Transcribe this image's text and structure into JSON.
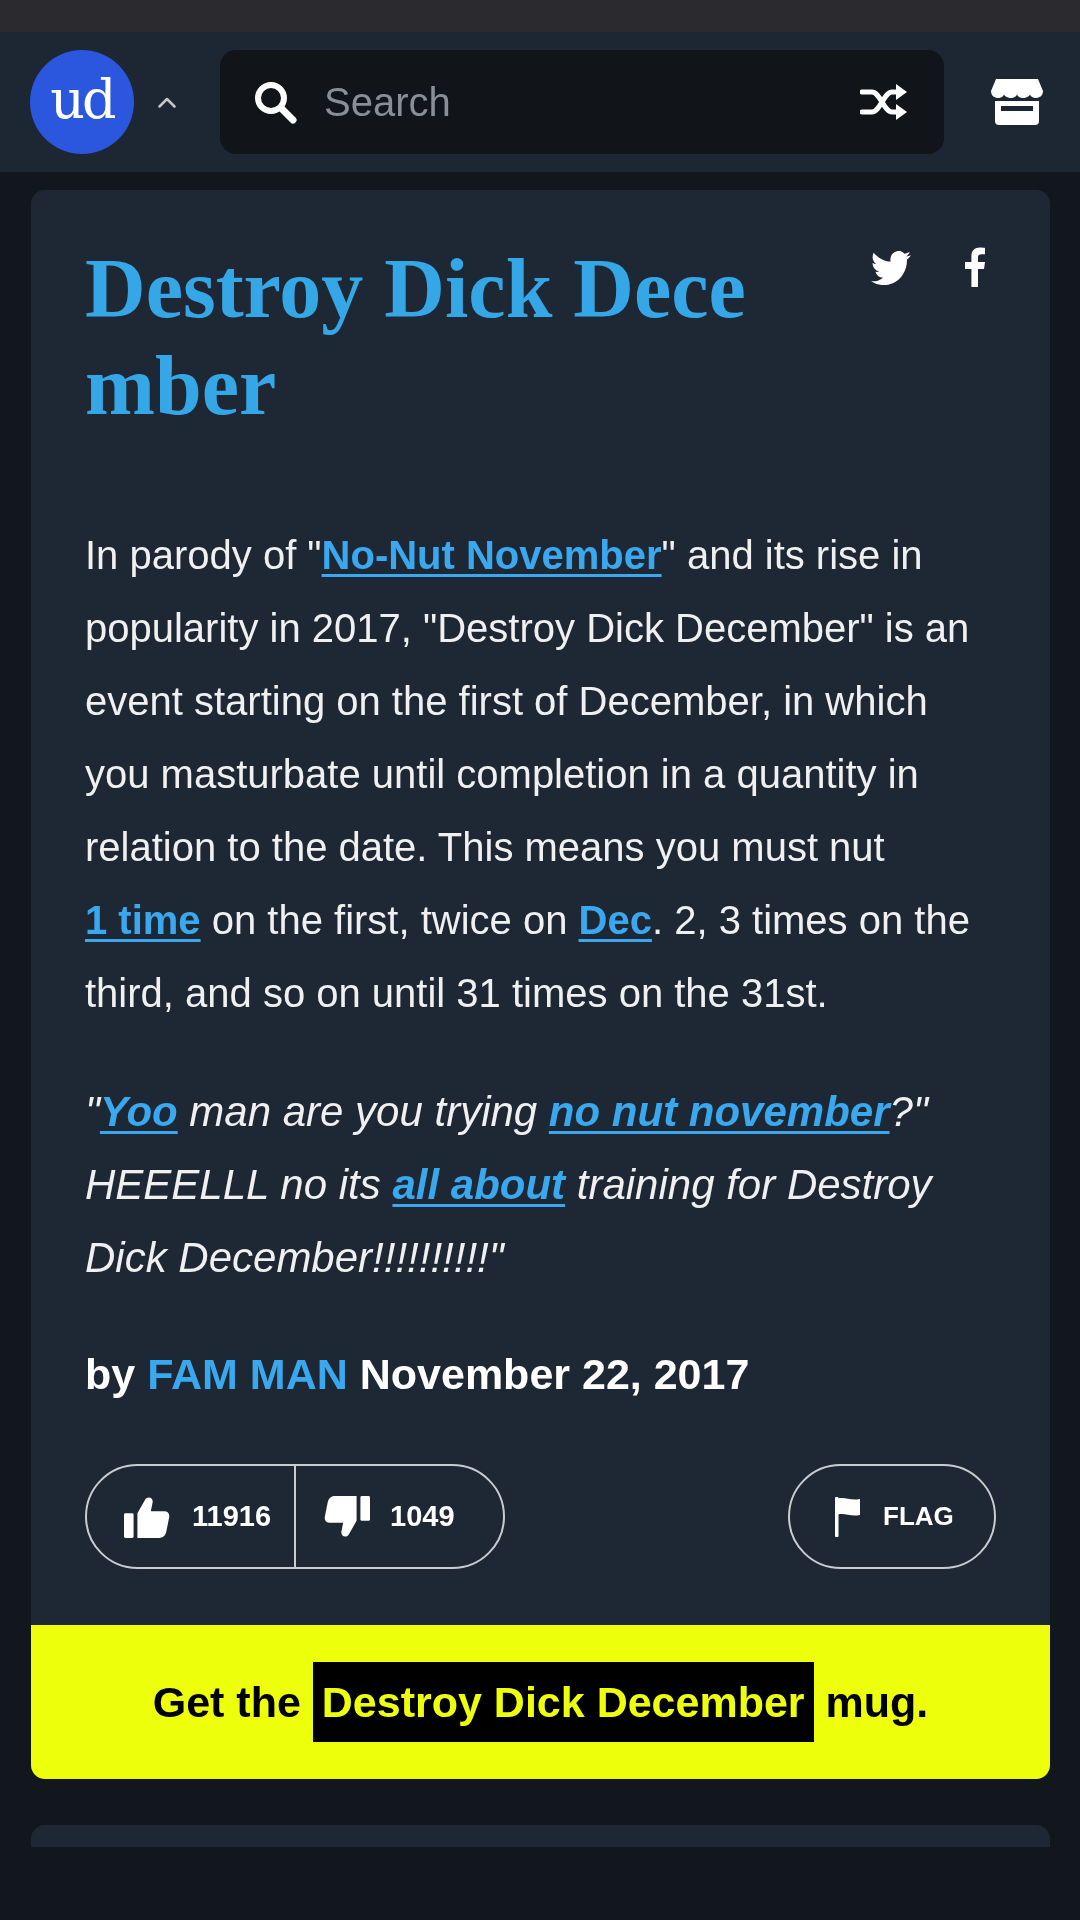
{
  "header": {
    "logo": "ud",
    "search": {
      "placeholder": "Search"
    }
  },
  "definition": {
    "title": "Destroy Dick December",
    "meaning": [
      {
        "kind": "text",
        "text": "In parody of \""
      },
      {
        "kind": "link",
        "text": "No-Nut November"
      },
      {
        "kind": "text",
        "text": "\" and its rise in popularity in 2017, \"Destroy Dick December\" is an event starting on the first of December, in which you masturbate until completion in a quantity in relation to the date. This means you must nut "
      },
      {
        "kind": "link",
        "text": "1 time"
      },
      {
        "kind": "text",
        "text": " on the first, twice on "
      },
      {
        "kind": "link",
        "text": "Dec"
      },
      {
        "kind": "text",
        "text": ". 2, 3 times on the third, and so on until 31 times on the 31st."
      }
    ],
    "example": [
      {
        "kind": "text",
        "text": "\""
      },
      {
        "kind": "link",
        "text": "Yoo"
      },
      {
        "kind": "text",
        "text": " man are you trying "
      },
      {
        "kind": "link",
        "text": "no nut november"
      },
      {
        "kind": "text",
        "text": "?\" HEEELLL no its "
      },
      {
        "kind": "link",
        "text": "all about"
      },
      {
        "kind": "text",
        "text": " training for Destroy Dick December!!!!!!!!!!\""
      }
    ],
    "byline": [
      {
        "kind": "text",
        "text": "by "
      },
      {
        "kind": "link",
        "text": "FAM MAN"
      },
      {
        "kind": "text",
        "text": " November 22, 2017"
      }
    ],
    "votes": {
      "up": "11916",
      "down": "1049"
    },
    "flag": "FLAG"
  },
  "mug_banner": {
    "parts": [
      {
        "kind": "text",
        "text": "Get the "
      },
      {
        "kind": "highlight",
        "text": "Destroy Dick December"
      },
      {
        "kind": "text",
        "text": " mug."
      }
    ]
  }
}
